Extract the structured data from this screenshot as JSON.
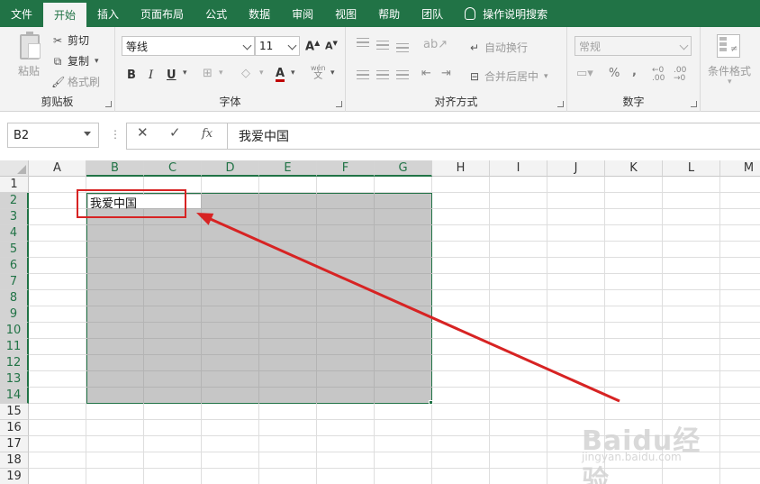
{
  "tabs": [
    "文件",
    "开始",
    "插入",
    "页面布局",
    "公式",
    "数据",
    "审阅",
    "视图",
    "帮助",
    "团队"
  ],
  "active_tab": "开始",
  "tell_me": "操作说明搜索",
  "ribbon": {
    "clipboard": {
      "label": "剪贴板",
      "paste": "粘贴",
      "cut": "剪切",
      "copy": "复制",
      "format_painter": "格式刷"
    },
    "font": {
      "label": "字体",
      "font_name": "等线",
      "font_size": "11",
      "grow": "A",
      "shrink": "A",
      "bold": "B",
      "italic": "I",
      "underline": "U",
      "font_color": "A",
      "phonetic_top": "wén",
      "phonetic_bottom": "文"
    },
    "alignment": {
      "label": "对齐方式",
      "wrap_text": "自动换行",
      "merge_center": "合并后居中"
    },
    "number": {
      "label": "数字",
      "format": "常规",
      "percent": "%",
      "comma": ",",
      "inc_decimal": "←0 .00",
      "dec_decimal": ".00 →0"
    },
    "styles": {
      "conditional_format": "条件格式"
    }
  },
  "formula_bar": {
    "name_box": "B2",
    "cancel": "✕",
    "enter": "✓",
    "fx": "fx",
    "content": "我爱中国"
  },
  "columns": [
    "A",
    "B",
    "C",
    "D",
    "E",
    "F",
    "G",
    "H",
    "I",
    "J",
    "K",
    "L",
    "M"
  ],
  "selected_columns": [
    "B",
    "C",
    "D",
    "E",
    "F",
    "G"
  ],
  "rows": [
    "1",
    "2",
    "3",
    "4",
    "5",
    "6",
    "7",
    "8",
    "9",
    "10",
    "11",
    "12",
    "13",
    "14",
    "15",
    "16",
    "17",
    "18",
    "19"
  ],
  "selected_rows": [
    "2",
    "3",
    "4",
    "5",
    "6",
    "7",
    "8",
    "9",
    "10",
    "11",
    "12",
    "13",
    "14"
  ],
  "cells": {
    "B2": "我爱中国"
  },
  "selection": {
    "range": "B2:G14",
    "active_cell": "B2"
  },
  "annotation": {
    "color": "#d72323"
  },
  "watermark": {
    "text": "Baidu经验",
    "url": "jingyan.baidu.com"
  },
  "colors": {
    "excel_green": "#217346",
    "selection_fill": "#c6c6c6",
    "ribbon_bg": "#f3f3f3"
  }
}
